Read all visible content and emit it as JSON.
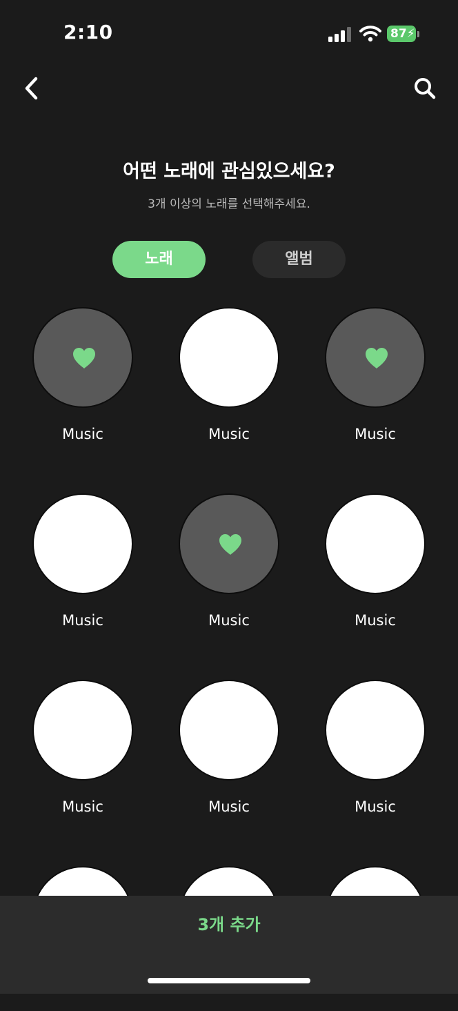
{
  "status_bar": {
    "time": "2:10",
    "battery_level": "87",
    "battery_color": "#5bc86b"
  },
  "header": {
    "back_icon": "chevron-left-icon",
    "search_icon": "search-icon"
  },
  "main": {
    "title": "어떤 노래에 관심있으세요?",
    "subtitle": "3개 이상의 노래를 선택해주세요.",
    "tabs": [
      {
        "label": "노래",
        "active": true
      },
      {
        "label": "앨범",
        "active": false
      }
    ],
    "items": [
      {
        "label": "Music",
        "selected": true
      },
      {
        "label": "Music",
        "selected": false
      },
      {
        "label": "Music",
        "selected": true
      },
      {
        "label": "Music",
        "selected": false
      },
      {
        "label": "Music",
        "selected": true
      },
      {
        "label": "Music",
        "selected": false
      },
      {
        "label": "Music",
        "selected": false
      },
      {
        "label": "Music",
        "selected": false
      },
      {
        "label": "Music",
        "selected": false
      },
      {
        "label": "",
        "selected": false
      },
      {
        "label": "",
        "selected": false
      },
      {
        "label": "",
        "selected": false
      }
    ],
    "accent_color": "#7bd98a",
    "selected_icon": "heart-icon"
  },
  "bottom_bar": {
    "add_button_label": "3개 추가"
  }
}
